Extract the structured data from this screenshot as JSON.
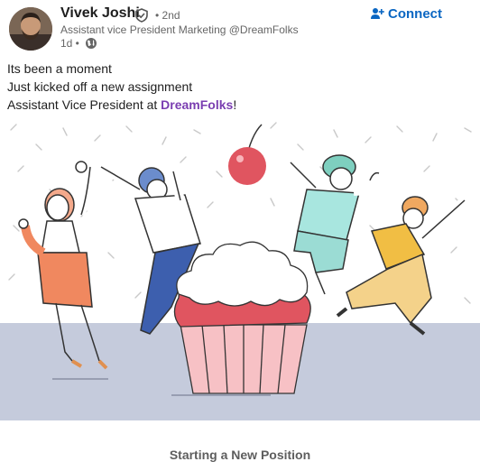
{
  "author": {
    "name": "Vivek Joshi",
    "degree": "• 2nd",
    "headline": "Assistant vice President Marketing @DreamFolks",
    "time": "1d •"
  },
  "actions": {
    "connect_label": "Connect"
  },
  "post": {
    "line1": "Its been a moment",
    "line2": "Just kicked off a new assignment",
    "line3_prefix": "Assistant Vice President at ",
    "line3_company": "DreamFolks",
    "line3_suffix": "!"
  },
  "celebration": {
    "caption": "Starting a New Position"
  },
  "icons": {
    "verified": "shield-check-icon",
    "visibility": "globe-icon",
    "connect": "add-person-icon"
  },
  "colors": {
    "link_blue": "#0a66c2",
    "company_purple": "#7a3eb1",
    "floor": "#c5cbdc"
  }
}
